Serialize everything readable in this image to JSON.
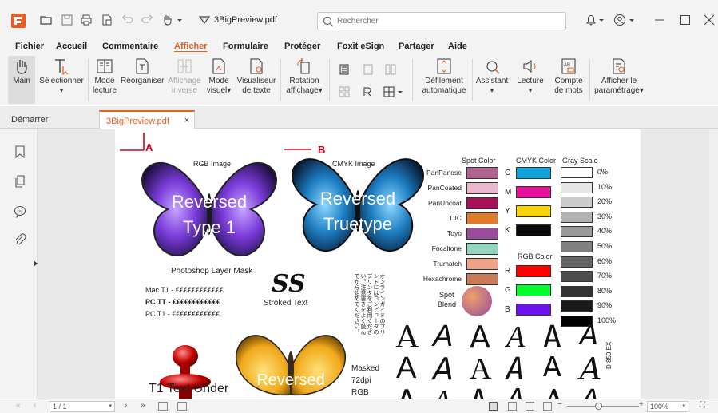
{
  "app": {
    "doc_title": "3BigPreview.pdf",
    "search_placeholder": "Rechercher"
  },
  "menu": [
    "Fichier",
    "Accueil",
    "Commentaire",
    "Afficher",
    "Formulaire",
    "Protéger",
    "Foxit eSign",
    "Partager",
    "Aide"
  ],
  "active_menu": "Afficher",
  "ribbon": {
    "main": "Main",
    "selectionner": "Sélectionner",
    "mode_lecture_1": "Mode",
    "mode_lecture_2": "lecture",
    "reorganiser": "Réorganiser",
    "affichage_inverse_1": "Affichage",
    "affichage_inverse_2": "inverse",
    "mode_visuel_1": "Mode",
    "mode_visuel_2": "visuel",
    "visualiseur_1": "Visualiseur",
    "visualiseur_2": "de texte",
    "rotation_1": "Rotation",
    "rotation_2": "affichage",
    "defilement_1": "Défilement",
    "defilement_2": "automatique",
    "assistant": "Assistant",
    "lecture": "Lecture",
    "compte_1": "Compte",
    "compte_2": "de mots",
    "parametrage_1": "Afficher le",
    "parametrage_2": "paramétrage"
  },
  "tabs": {
    "start": "Démarrer",
    "doc": "3BigPreview.pdf",
    "close": "×"
  },
  "statusbar": {
    "page": "1 / 1",
    "zoom": "100%"
  },
  "page_content": {
    "marker_a": "A",
    "marker_b": "B",
    "rgb_image": "RGB Image",
    "cmyk_image": "CMYK Image",
    "rev_type1_1": "Reversed",
    "rev_type1_2": "Type 1",
    "rev_truetype_1": "Reversed",
    "rev_truetype_2": "Truetype",
    "photoshop_mask": "Photoshop Layer Mask",
    "mac_t1": "Mac T1 - €€€€€€€€€€€€",
    "pc_tt": "PC TT - €€€€€€€€€€€€",
    "pc_t1": "PC T1 - €€€€€€€€€€€€",
    "ss": "SS",
    "stroked_text": "Stroked Text",
    "spot_color": "Spot Color",
    "cmyk_color": "CMYK Color",
    "gray_scale": "Gray Scale",
    "rgb_color": "RGB Color",
    "spot_blend_1": "Spot",
    "spot_blend_2": "Blend",
    "masked": "Masked",
    "dpi": "72dpi",
    "rgb": "RGB",
    "t1_text": "T1 Text Under",
    "reversed_bottom": "Reversed",
    "side_code": "D 850 EX",
    "jp_text": "オンラインガイドのプリントにはコンピュータのプリンタをご利用ください。注意書きをよく読んでから始めてください。"
  },
  "spot_colors": [
    {
      "label": "PanPanose",
      "color": "#b0638e"
    },
    {
      "label": "PanCoated",
      "color": "#e9b8cf"
    },
    {
      "label": "PanUncoat",
      "color": "#a8115a"
    },
    {
      "label": "DIC",
      "color": "#e07b2a"
    },
    {
      "label": "Toyo",
      "color": "#9b4b9c"
    },
    {
      "label": "Focaltone",
      "color": "#93d5c1"
    },
    {
      "label": "Trumatch",
      "color": "#f1a389"
    },
    {
      "label": "Hexachrome",
      "color": "#c77b59"
    }
  ],
  "cmyk_colors": [
    {
      "label": "C",
      "color": "#0fa3d7"
    },
    {
      "label": "M",
      "color": "#e5139c"
    },
    {
      "label": "Y",
      "color": "#f8d20b"
    },
    {
      "label": "K",
      "color": "#0a0a0a"
    }
  ],
  "rgb_colors": [
    {
      "label": "R",
      "color": "#ff0000"
    },
    {
      "label": "G",
      "color": "#00ff2a"
    },
    {
      "label": "B",
      "color": "#6a12f0"
    }
  ],
  "gray_scale": [
    {
      "label": "0%",
      "color": "#ffffff"
    },
    {
      "label": "10%",
      "color": "#e6e6e6"
    },
    {
      "label": "20%",
      "color": "#cccccc"
    },
    {
      "label": "30%",
      "color": "#b3b3b3"
    },
    {
      "label": "40%",
      "color": "#999999"
    },
    {
      "label": "50%",
      "color": "#808080"
    },
    {
      "label": "60%",
      "color": "#666666"
    },
    {
      "label": "70%",
      "color": "#4d4d4d"
    },
    {
      "label": "80%",
      "color": "#333333"
    },
    {
      "label": "90%",
      "color": "#1a1a1a"
    },
    {
      "label": "100%",
      "color": "#000000"
    }
  ],
  "glyph_char": "A",
  "colors": {
    "accent": "#e85d22",
    "marker_red": "#d0021b"
  }
}
